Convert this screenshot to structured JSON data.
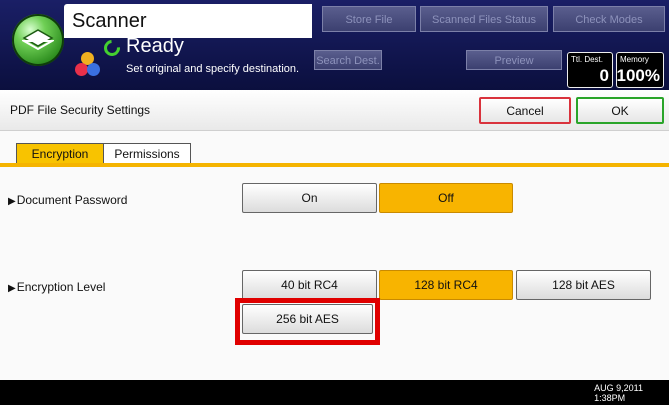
{
  "header": {
    "app_title": "Scanner",
    "store_file": "Store File",
    "scanned_files_status": "Scanned Files Status",
    "check_modes": "Check Modes",
    "search_dest": "Search Dest.",
    "preview": "Preview",
    "status": "Ready",
    "status_message": "Set original and specify destination.",
    "ttl_dest_label": "Ttl. Dest.",
    "ttl_dest_value": "0",
    "memory_label": "Memory",
    "memory_value": "100%"
  },
  "dialog": {
    "title": "PDF File Security Settings",
    "cancel_label": "Cancel",
    "ok_label": "OK"
  },
  "tabs": [
    {
      "label": "Encryption",
      "active": true
    },
    {
      "label": "Permissions",
      "active": false
    }
  ],
  "document_password": {
    "label": "Document Password",
    "options": [
      {
        "label": "On",
        "selected": false
      },
      {
        "label": "Off",
        "selected": true
      }
    ]
  },
  "encryption_level": {
    "label": "Encryption Level",
    "options": [
      {
        "label": "40 bit RC4",
        "selected": false
      },
      {
        "label": "128 bit RC4",
        "selected": true
      },
      {
        "label": "128 bit AES",
        "selected": false
      },
      {
        "label": "256 bit AES",
        "selected": false
      }
    ]
  },
  "footer": {
    "date": "AUG   9,2011",
    "time": "1:38PM"
  },
  "colors": {
    "selected": "#f8b400",
    "highlight": "#e00000",
    "cancel_border": "#d9323c",
    "ok_border": "#2aa52a"
  }
}
